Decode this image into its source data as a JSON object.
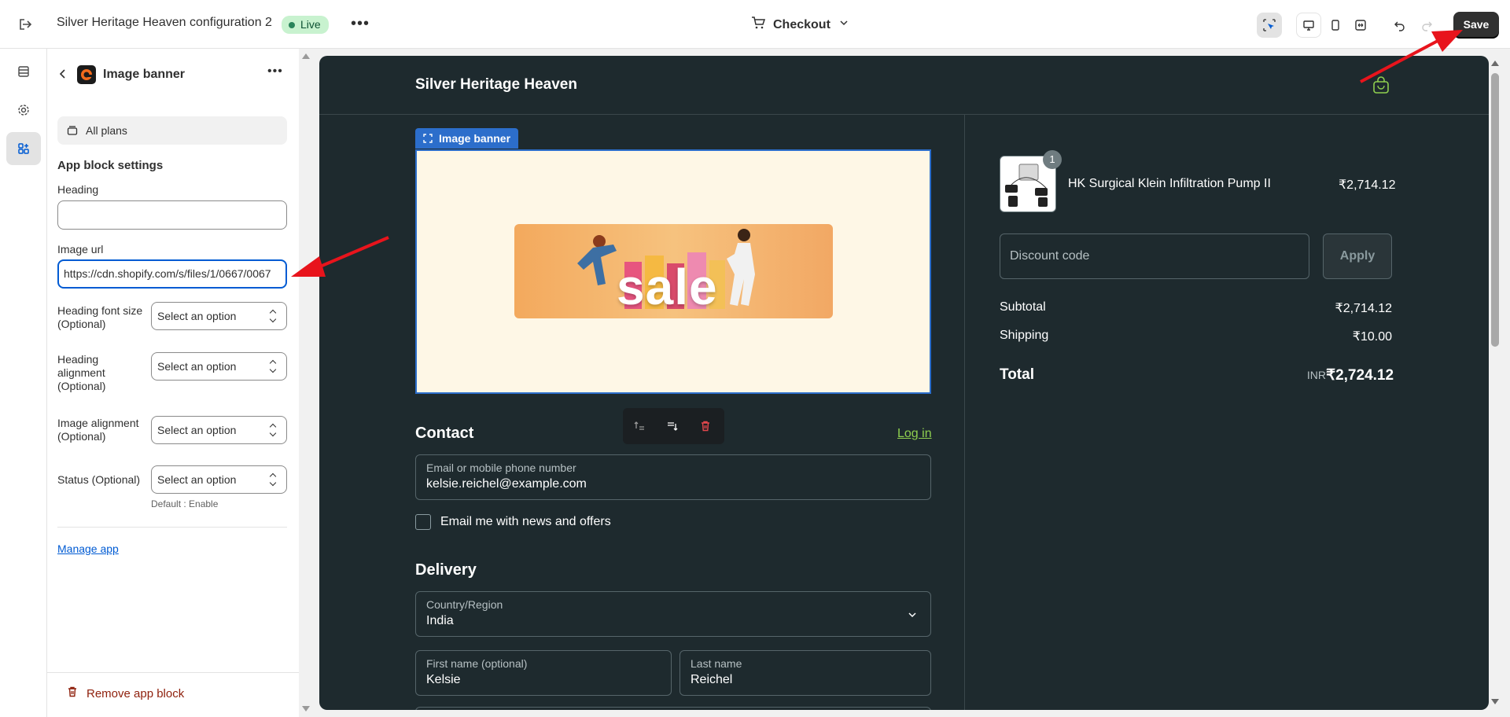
{
  "topbar": {
    "title": "Silver Heritage Heaven configuration 2",
    "live_badge": "Live",
    "more": "•••",
    "page_selector": "Checkout",
    "save_label": "Save"
  },
  "panel": {
    "block_title": "Image banner",
    "more": "•••",
    "plans": "All plans",
    "section_title": "App block settings",
    "heading_label": "Heading",
    "heading_value": "",
    "image_url_label": "Image url",
    "image_url_value": "https://cdn.shopify.com/s/files/1/0667/0067",
    "heading_font_size_label_1": "Heading font size",
    "heading_font_size_label_2": "(Optional)",
    "heading_alignment_label_1": "Heading",
    "heading_alignment_label_2": "alignment",
    "heading_alignment_label_3": "(Optional)",
    "image_alignment_label_1": "Image alignment",
    "image_alignment_label_2": "(Optional)",
    "status_label": "Status (Optional)",
    "select_placeholder": "Select an option",
    "status_hint": "Default : Enable",
    "manage_app": "Manage app",
    "remove_block": "Remove app block"
  },
  "preview": {
    "store_name": "Silver Heritage Heaven",
    "image_banner_tag": "Image banner",
    "sale_text": "sale",
    "contact_heading": "Contact",
    "login": "Log in",
    "email_label": "Email or mobile phone number",
    "email_value": "kelsie.reichel@example.com",
    "newsletter": "Email me with news and offers",
    "delivery_heading": "Delivery",
    "country_label": "Country/Region",
    "country_value": "India",
    "first_name_label": "First name (optional)",
    "first_name_value": "Kelsie",
    "last_name_label": "Last name",
    "last_name_value": "Reichel"
  },
  "summary": {
    "qty": "1",
    "product_name": "HK Surgical Klein Infiltration Pump II",
    "product_price": "₹2,714.12",
    "discount_placeholder": "Discount code",
    "apply": "Apply",
    "subtotal_label": "Subtotal",
    "subtotal_value": "₹2,714.12",
    "shipping_label": "Shipping",
    "shipping_value": "₹10.00",
    "total_label": "Total",
    "currency": "INR",
    "total_value": "₹2,724.12"
  },
  "colors": {
    "accent": "#005bd3",
    "preview_bg": "#1e2a2e",
    "live_green": "#c8f2cf",
    "annotation_arrow": "#e8141c",
    "link_green": "#8fcf4f"
  },
  "icons": [
    "exit-icon",
    "more-icon",
    "cart-icon",
    "chevron-down-icon",
    "inspector-icon",
    "desktop-icon",
    "mobile-icon",
    "fullwidth-icon",
    "undo-icon",
    "redo-icon",
    "sections-icon",
    "gear-icon",
    "apps-icon",
    "back-icon",
    "app-logo-icon",
    "plans-icon",
    "trash-icon",
    "bag-icon",
    "move-up-icon",
    "move-down-icon"
  ]
}
